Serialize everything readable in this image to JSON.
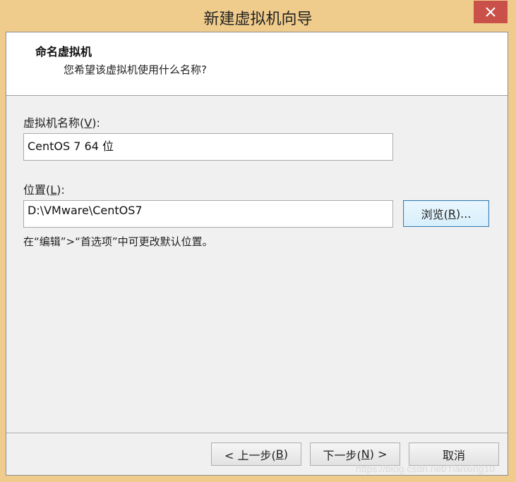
{
  "window": {
    "title": "新建虚拟机向导"
  },
  "header": {
    "title": "命名虚拟机",
    "subtitle": "您希望该虚拟机使用什么名称?"
  },
  "form": {
    "name_label": "虚拟机名称(",
    "name_mnemonic": "V",
    "name_label_end": "):",
    "name_value": "CentOS 7 64 位",
    "location_label": "位置(",
    "location_mnemonic": "L",
    "location_label_end": "):",
    "location_value": "D:\\VMware\\CentOS7",
    "browse_label": "浏览(",
    "browse_mnemonic": "R",
    "browse_label_end": ")...",
    "hint": "在“编辑”>“首选项”中可更改默认位置。"
  },
  "footer": {
    "back_label": "< 上一步(",
    "back_mnemonic": "B",
    "back_end": ")",
    "next_label": "下一步(",
    "next_mnemonic": "N",
    "next_end": ") >",
    "cancel_label": "取消"
  },
  "watermark": "https://blog.csdn.net/Tianxing10",
  "colors": {
    "frame": "#f0cc8c",
    "close": "#c9514a",
    "focus_border": "#3c7fb1"
  },
  "icons": {
    "close": "close-icon"
  }
}
